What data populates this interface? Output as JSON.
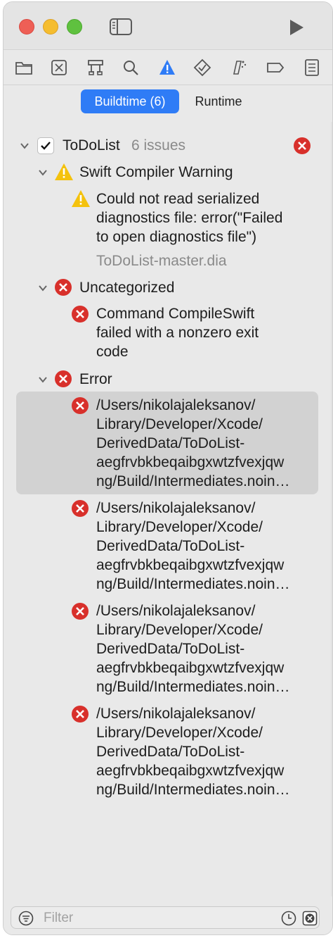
{
  "toolbar": {
    "traffic_lights": [
      "close",
      "minimize",
      "zoom"
    ],
    "icons": [
      "sidebar-toggle-icon",
      "run-icon"
    ]
  },
  "navigator": {
    "icons": [
      "folder-icon",
      "source-control-icon",
      "symbol-icon",
      "search-icon",
      "issue-icon",
      "test-icon",
      "debug-icon",
      "breakpoint-icon",
      "report-icon"
    ],
    "active": "issue-icon",
    "active_color": "#2f7cf6"
  },
  "segments": {
    "buildtime": "Buildtime (6)",
    "runtime": "Runtime"
  },
  "project": {
    "name": "ToDoList",
    "count": "6 issues"
  },
  "groups": [
    {
      "title": "Swift Compiler Warning",
      "items": [
        {
          "text": "Could not read serialized\ndiagnostics file: error(\"Failed\nto open diagnostics file\")",
          "detail": "ToDoList-master.dia"
        }
      ]
    },
    {
      "title": "Uncategorized",
      "items": [
        {
          "text": "Command CompileSwift\nfailed with a nonzero exit\ncode"
        }
      ]
    },
    {
      "title": "Error",
      "items": [
        {
          "text": "/Users/nikolajaleksanov/\nLibrary/Developer/Xcode/\nDerivedData/ToDoList-\naegfrvbkbeqaibgxwtzfvexjqw\nng/Build/Intermediates.noin…"
        },
        {
          "text": "/Users/nikolajaleksanov/\nLibrary/Developer/Xcode/\nDerivedData/ToDoList-\naegfrvbkbeqaibgxwtzfvexjqw\nng/Build/Intermediates.noin…"
        },
        {
          "text": "/Users/nikolajaleksanov/\nLibrary/Developer/Xcode/\nDerivedData/ToDoList-\naegfrvbkbeqaibgxwtzfvexjqw\nng/Build/Intermediates.noin…"
        },
        {
          "text": "/Users/nikolajaleksanov/\nLibrary/Developer/Xcode/\nDerivedData/ToDoList-\naegfrvbkbeqaibgxwtzfvexjqw\nng/Build/Intermediates.noin…"
        }
      ]
    }
  ],
  "filter": {
    "placeholder": "Filter"
  },
  "colors": {
    "error": "#d8302b",
    "warning": "#f4c20d",
    "selection": "#d2d2d2"
  }
}
